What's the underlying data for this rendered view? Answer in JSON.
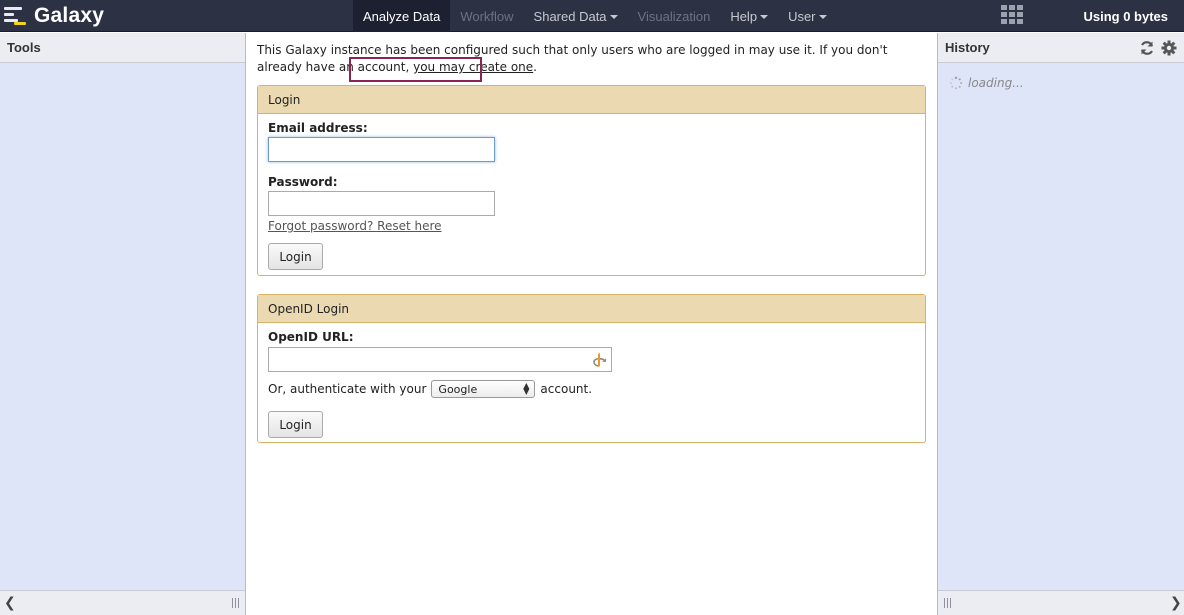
{
  "brand": {
    "title": "Galaxy"
  },
  "nav": {
    "tabs": [
      {
        "label": "Analyze Data",
        "state": "active"
      },
      {
        "label": "Workflow",
        "state": "disabled"
      },
      {
        "label": "Shared Data",
        "dropdown": true
      },
      {
        "label": "Visualization",
        "state": "disabled"
      },
      {
        "label": "Help",
        "dropdown": true
      },
      {
        "label": "User",
        "dropdown": true
      }
    ],
    "grid_icon": "grid-icon",
    "usage": "Using 0 bytes"
  },
  "tools_panel": {
    "title": "Tools"
  },
  "history_panel": {
    "title": "History",
    "loading_text": "loading...",
    "icons": [
      "refresh-icon",
      "gear-icon"
    ]
  },
  "intro": {
    "text_before": "This Galaxy instance has been configured such that only users who are logged in may use it. If you don't already have an account,",
    "link_text": "you may create one",
    "text_after": "."
  },
  "login_form": {
    "title": "Login",
    "email_label": "Email address:",
    "email_value": "",
    "password_label": "Password:",
    "password_value": "",
    "forgot_link": "Forgot password? Reset here",
    "submit_label": "Login"
  },
  "openid_form": {
    "title": "OpenID Login",
    "url_label": "OpenID URL:",
    "url_value": "",
    "auth_prefix": "Or, authenticate with your",
    "provider_selected": "Google",
    "auth_suffix": "account.",
    "submit_label": "Login"
  },
  "colors": {
    "masthead": "#2c3143",
    "panel_bg": "#dfe5f9",
    "form_header": "#ebd9b2",
    "form_border": "#d8b365",
    "highlight_box": "#8b2453"
  }
}
